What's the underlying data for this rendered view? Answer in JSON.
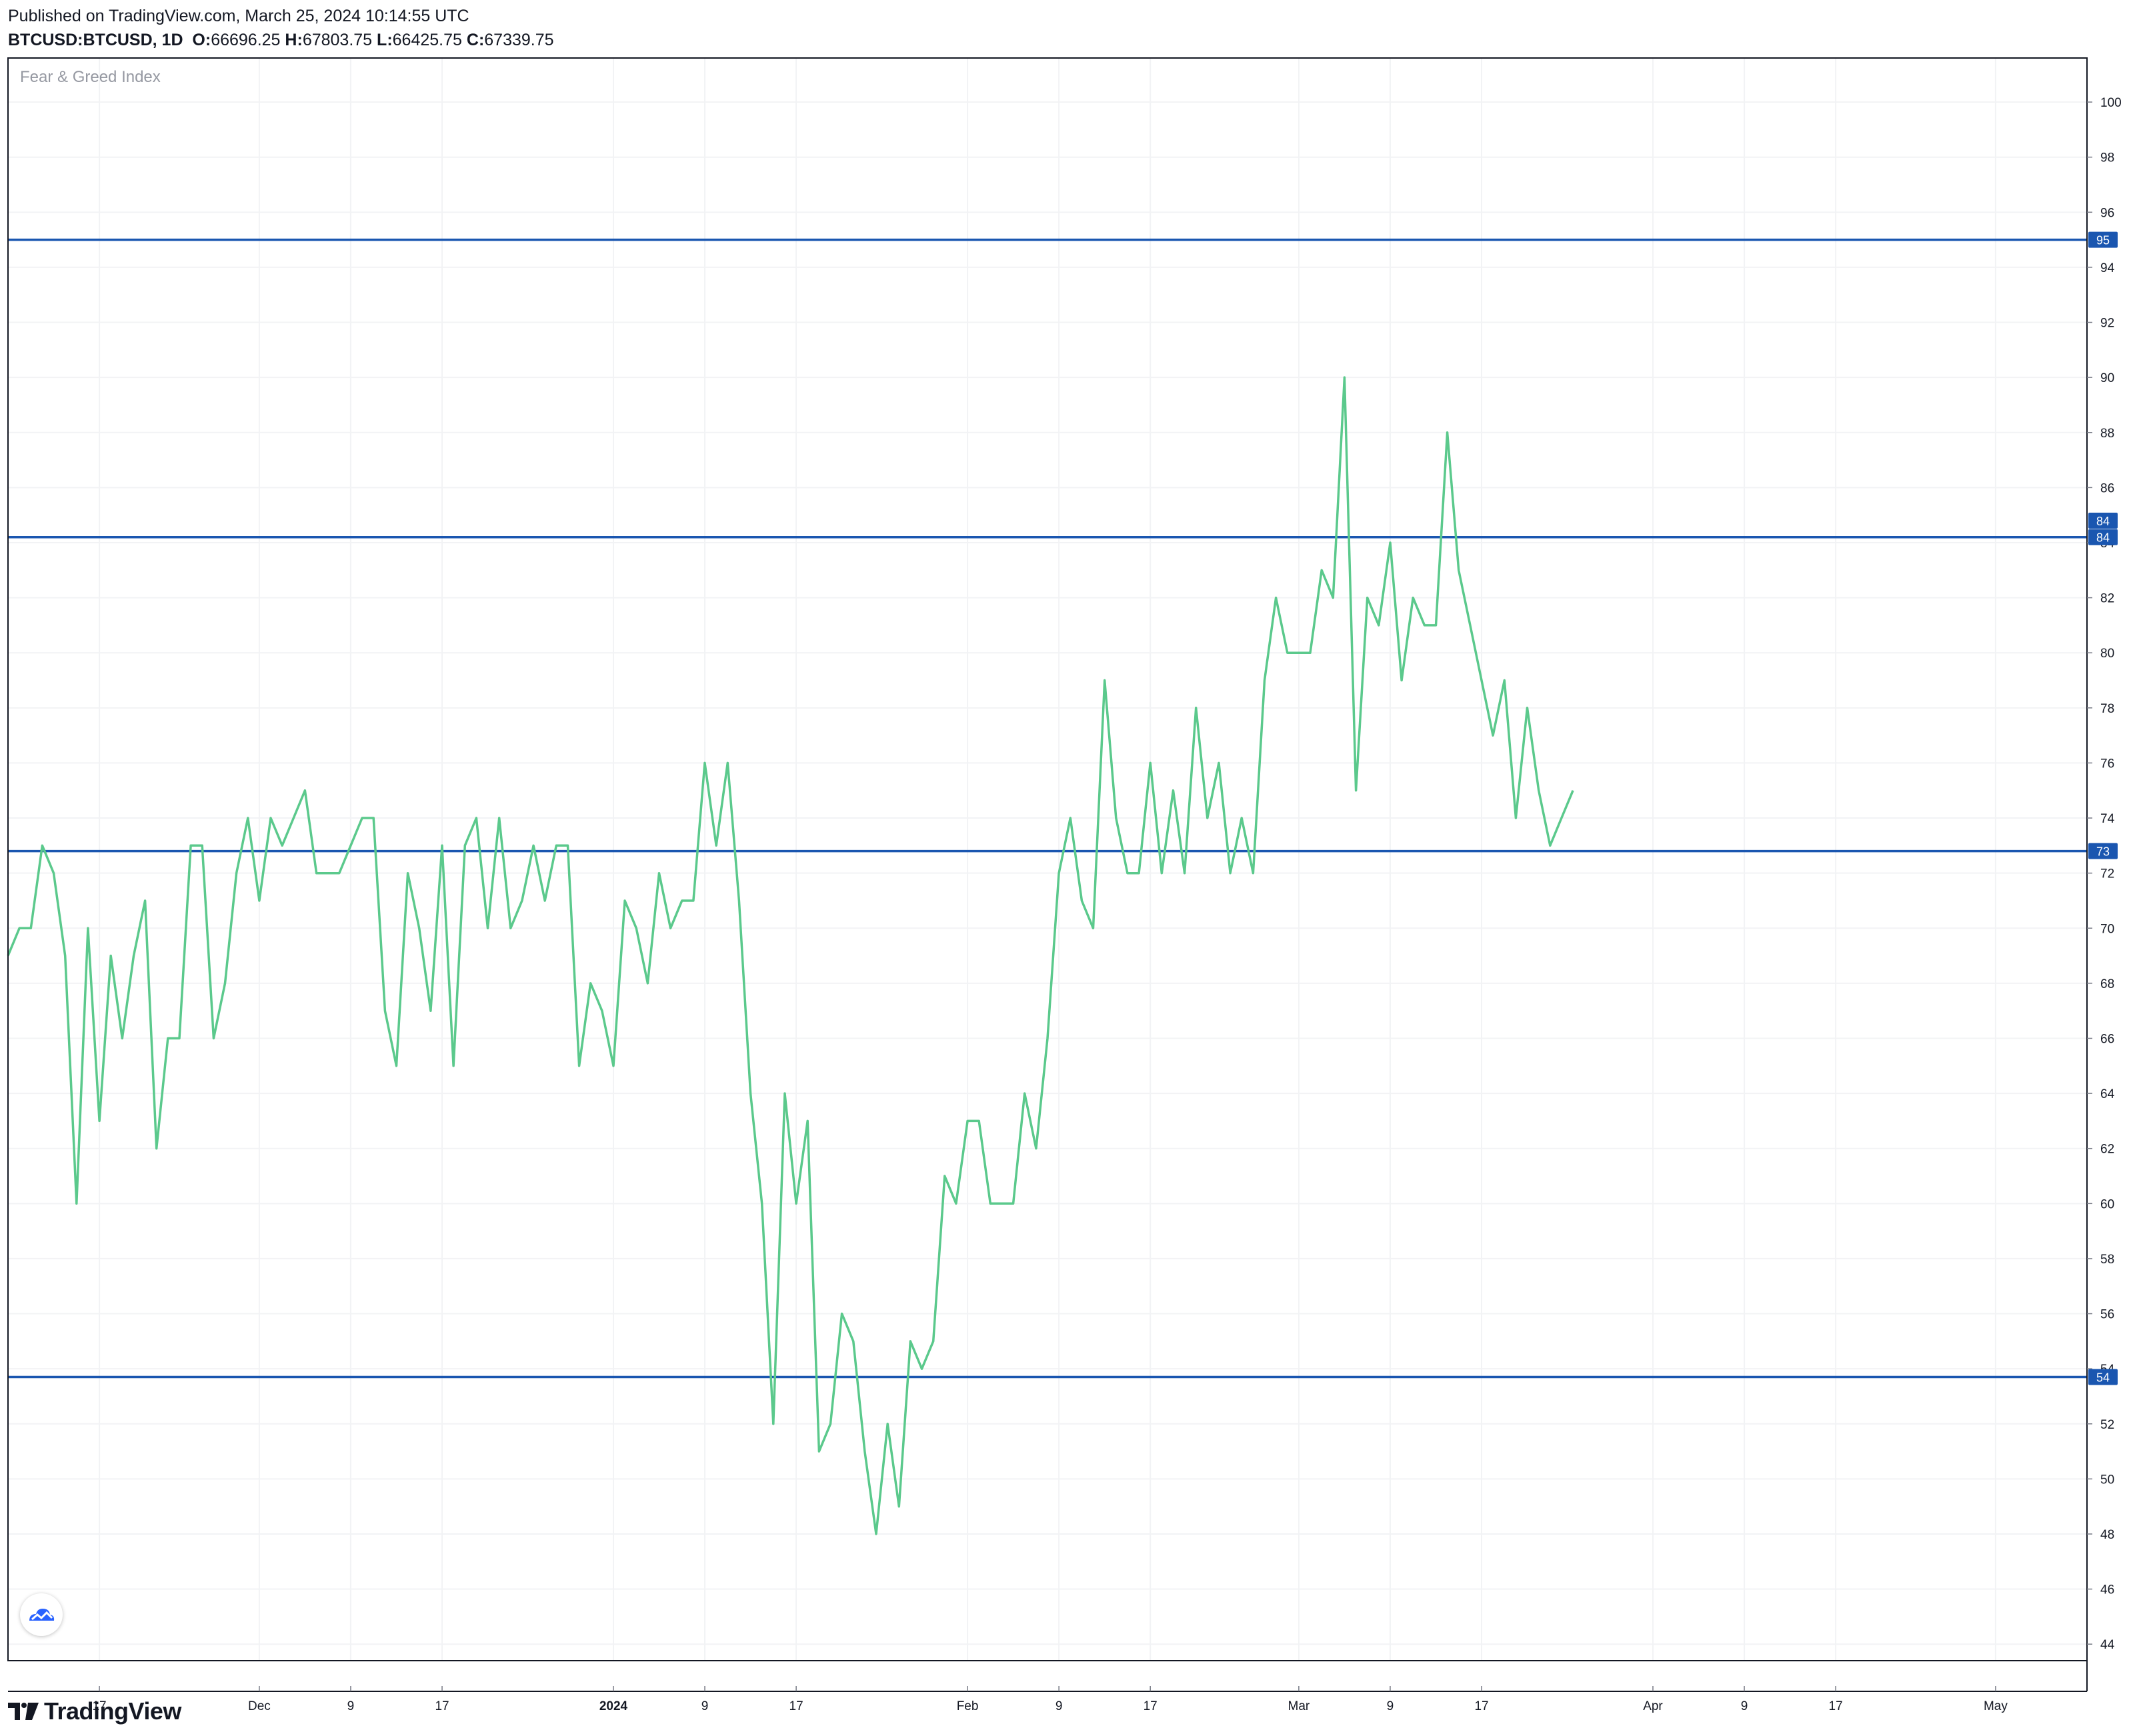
{
  "header": {
    "published": "Published on TradingView.com, March 25, 2024 10:14:55 UTC",
    "symbol": "BTCUSD:BTCUSD, 1D",
    "open_label": "O:",
    "open": "66696.25",
    "high_label": "H:",
    "high": "67803.75",
    "low_label": "L:",
    "low": "66425.75",
    "close_label": "C:",
    "close": "67339.75"
  },
  "indicator": {
    "name": "Fear & Greed Index"
  },
  "footer": {
    "brand": "TradingView"
  },
  "colors": {
    "line": "#5bc98c",
    "hline": "#1a56b0",
    "grid": "#f2f3f5",
    "axis": "#787b86",
    "label_bg": "#1a56b0"
  },
  "chart_data": {
    "type": "line",
    "title": "Fear & Greed Index",
    "ylim": [
      43.4,
      101.6
    ],
    "y_ticks": [
      44,
      46,
      48,
      50,
      52,
      54,
      56,
      58,
      60,
      62,
      64,
      66,
      68,
      70,
      72,
      74,
      76,
      78,
      80,
      82,
      84,
      86,
      88,
      90,
      92,
      94,
      96,
      98,
      100
    ],
    "x_start_date": "2023-11-09",
    "x_end_date": "2024-05-09",
    "x_ticks": [
      {
        "date": "2023-11-17",
        "label": "17",
        "bold": false
      },
      {
        "date": "2023-12-01",
        "label": "Dec",
        "bold": false
      },
      {
        "date": "2023-12-09",
        "label": "9",
        "bold": false
      },
      {
        "date": "2023-12-17",
        "label": "17",
        "bold": false
      },
      {
        "date": "2024-01-01",
        "label": "2024",
        "bold": true
      },
      {
        "date": "2024-01-09",
        "label": "9",
        "bold": false
      },
      {
        "date": "2024-01-17",
        "label": "17",
        "bold": false
      },
      {
        "date": "2024-02-01",
        "label": "Feb",
        "bold": false
      },
      {
        "date": "2024-02-09",
        "label": "9",
        "bold": false
      },
      {
        "date": "2024-02-17",
        "label": "17",
        "bold": false
      },
      {
        "date": "2024-03-01",
        "label": "Mar",
        "bold": false
      },
      {
        "date": "2024-03-09",
        "label": "9",
        "bold": false
      },
      {
        "date": "2024-03-17",
        "label": "17",
        "bold": false
      },
      {
        "date": "2024-04-01",
        "label": "Apr",
        "bold": false
      },
      {
        "date": "2024-04-09",
        "label": "9",
        "bold": false
      },
      {
        "date": "2024-04-17",
        "label": "17",
        "bold": false
      },
      {
        "date": "2024-05-01",
        "label": "May",
        "bold": false
      }
    ],
    "horizontal_lines": [
      {
        "value": 95,
        "label": "95"
      },
      {
        "value": 84.2,
        "label": "84"
      },
      {
        "value": 72.8,
        "label": "73"
      },
      {
        "value": 53.7,
        "label": "54"
      }
    ],
    "extra_price_labels": [
      {
        "value": 84.8,
        "label": "84"
      }
    ],
    "series": [
      {
        "dates": [
          "2023-11-09",
          "2023-11-10",
          "2023-11-11",
          "2023-11-12",
          "2023-11-13",
          "2023-11-14",
          "2023-11-15",
          "2023-11-16",
          "2023-11-17",
          "2023-11-18",
          "2023-11-19",
          "2023-11-20",
          "2023-11-21",
          "2023-11-22",
          "2023-11-23",
          "2023-11-24",
          "2023-11-25",
          "2023-11-26",
          "2023-11-27",
          "2023-11-28",
          "2023-11-29",
          "2023-11-30",
          "2023-12-01",
          "2023-12-02",
          "2023-12-03",
          "2023-12-04",
          "2023-12-05",
          "2023-12-06",
          "2023-12-07",
          "2023-12-08",
          "2023-12-09",
          "2023-12-10",
          "2023-12-11",
          "2023-12-12",
          "2023-12-13",
          "2023-12-14",
          "2023-12-15",
          "2023-12-16",
          "2023-12-17",
          "2023-12-18",
          "2023-12-19",
          "2023-12-20",
          "2023-12-21",
          "2023-12-22",
          "2023-12-23",
          "2023-12-24",
          "2023-12-25",
          "2023-12-26",
          "2023-12-27",
          "2023-12-28",
          "2023-12-29",
          "2023-12-30",
          "2023-12-31",
          "2024-01-01",
          "2024-01-02",
          "2024-01-03",
          "2024-01-04",
          "2024-01-05",
          "2024-01-06",
          "2024-01-07",
          "2024-01-08",
          "2024-01-09",
          "2024-01-10",
          "2024-01-11",
          "2024-01-12",
          "2024-01-13",
          "2024-01-14",
          "2024-01-15",
          "2024-01-16",
          "2024-01-17",
          "2024-01-18",
          "2024-01-19",
          "2024-01-20",
          "2024-01-21",
          "2024-01-22",
          "2024-01-23",
          "2024-01-24",
          "2024-01-25",
          "2024-01-26",
          "2024-01-27",
          "2024-01-28",
          "2024-01-29",
          "2024-01-30",
          "2024-01-31",
          "2024-02-01",
          "2024-02-02",
          "2024-02-03",
          "2024-02-04",
          "2024-02-05",
          "2024-02-06",
          "2024-02-07",
          "2024-02-08",
          "2024-02-09",
          "2024-02-10",
          "2024-02-11",
          "2024-02-12",
          "2024-02-13",
          "2024-02-14",
          "2024-02-15",
          "2024-02-16",
          "2024-02-17",
          "2024-02-18",
          "2024-02-19",
          "2024-02-20",
          "2024-02-21",
          "2024-02-22",
          "2024-02-23",
          "2024-02-24",
          "2024-02-25",
          "2024-02-26",
          "2024-02-27",
          "2024-02-28",
          "2024-02-29",
          "2024-03-01",
          "2024-03-02",
          "2024-03-03",
          "2024-03-04",
          "2024-03-05",
          "2024-03-06",
          "2024-03-07",
          "2024-03-08",
          "2024-03-09",
          "2024-03-10",
          "2024-03-11",
          "2024-03-12",
          "2024-03-13",
          "2024-03-14",
          "2024-03-15",
          "2024-03-16",
          "2024-03-17",
          "2024-03-18",
          "2024-03-19",
          "2024-03-20",
          "2024-03-21",
          "2024-03-22",
          "2024-03-23",
          "2024-03-24",
          "2024-03-25"
        ],
        "values": [
          69,
          70,
          70,
          73,
          72,
          69,
          60,
          70,
          63,
          69,
          66,
          69,
          71,
          62,
          66,
          66,
          73,
          73,
          66,
          68,
          72,
          74,
          71,
          74,
          73,
          74,
          75,
          72,
          72,
          72,
          73,
          74,
          74,
          67,
          65,
          72,
          70,
          67,
          73,
          65,
          73,
          74,
          70,
          74,
          70,
          71,
          73,
          71,
          73,
          73,
          65,
          68,
          67,
          65,
          71,
          70,
          68,
          72,
          70,
          71,
          71,
          76,
          73,
          76,
          71,
          64,
          60,
          52,
          64,
          60,
          63,
          51,
          52,
          56,
          55,
          51,
          48,
          52,
          49,
          55,
          54,
          55,
          61,
          60,
          63,
          63,
          60,
          60,
          60,
          64,
          62,
          66,
          72,
          74,
          71,
          70,
          79,
          74,
          72,
          72,
          76,
          72,
          75,
          72,
          78,
          74,
          76,
          72,
          74,
          72,
          79,
          82,
          80,
          80,
          80,
          83,
          82,
          90,
          75,
          82,
          81,
          84,
          79,
          82,
          81,
          81,
          88,
          83,
          81,
          79,
          77,
          79,
          74,
          78,
          75,
          73,
          74,
          75
        ]
      }
    ]
  }
}
